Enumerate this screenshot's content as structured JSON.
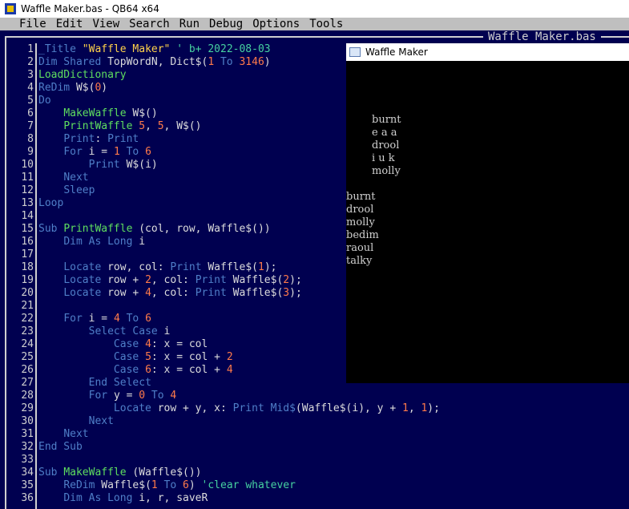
{
  "window": {
    "title": "Waffle Maker.bas - QB64 x64"
  },
  "menu": [
    "File",
    "Edit",
    "View",
    "Search",
    "Run",
    "Debug",
    "Options",
    "Tools"
  ],
  "editor": {
    "filename": "Waffle Maker.bas"
  },
  "line_numbers": [
    "1",
    "2",
    "3",
    "4",
    "5",
    "6",
    "7",
    "8",
    "9",
    "10",
    "11",
    "12",
    "13",
    "14",
    "15",
    "16",
    "17",
    "18",
    "19",
    "20",
    "21",
    "22",
    "23",
    "24",
    "25",
    "26",
    "27",
    "28",
    "29",
    "30",
    "31",
    "32",
    "33",
    "34",
    "35",
    "36"
  ],
  "code_lines": [
    [
      [
        "kw",
        "_Title "
      ],
      [
        "str",
        "\"Waffle Maker\""
      ],
      [
        "cm",
        " ' b+ 2022-08-03"
      ]
    ],
    [
      [
        "kw",
        "Dim Shared "
      ],
      [
        "txt",
        "TopWordN, Dict$("
      ],
      [
        "num",
        "1"
      ],
      [
        "kw",
        " To "
      ],
      [
        "num",
        "3146"
      ],
      [
        "txt",
        ")"
      ]
    ],
    [
      [
        "fn",
        "LoadDictionary"
      ]
    ],
    [
      [
        "kw",
        "ReDim "
      ],
      [
        "txt",
        "W$("
      ],
      [
        "num",
        "0"
      ],
      [
        "txt",
        ")"
      ]
    ],
    [
      [
        "kw",
        "Do"
      ]
    ],
    [
      [
        "txt",
        "    "
      ],
      [
        "fn",
        "MakeWaffle "
      ],
      [
        "txt",
        "W$()"
      ]
    ],
    [
      [
        "txt",
        "    "
      ],
      [
        "fn",
        "PrintWaffle "
      ],
      [
        "num",
        "5"
      ],
      [
        "txt",
        ", "
      ],
      [
        "num",
        "5"
      ],
      [
        "txt",
        ", W$()"
      ]
    ],
    [
      [
        "txt",
        "    "
      ],
      [
        "kw",
        "Print"
      ],
      [
        "txt",
        ": "
      ],
      [
        "kw",
        "Print"
      ]
    ],
    [
      [
        "txt",
        "    "
      ],
      [
        "kw",
        "For "
      ],
      [
        "txt",
        "i = "
      ],
      [
        "num",
        "1"
      ],
      [
        "kw",
        " To "
      ],
      [
        "num",
        "6"
      ]
    ],
    [
      [
        "txt",
        "        "
      ],
      [
        "kw",
        "Print "
      ],
      [
        "txt",
        "W$(i)"
      ]
    ],
    [
      [
        "txt",
        "    "
      ],
      [
        "kw",
        "Next"
      ]
    ],
    [
      [
        "txt",
        "    "
      ],
      [
        "kw",
        "Sleep"
      ]
    ],
    [
      [
        "kw",
        "Loop"
      ]
    ],
    [
      [
        "txt",
        ""
      ]
    ],
    [
      [
        "kw",
        "Sub "
      ],
      [
        "fn",
        "PrintWaffle "
      ],
      [
        "txt",
        "(col, row, Waffle$())"
      ]
    ],
    [
      [
        "txt",
        "    "
      ],
      [
        "kw",
        "Dim As Long "
      ],
      [
        "txt",
        "i"
      ]
    ],
    [
      [
        "txt",
        ""
      ]
    ],
    [
      [
        "txt",
        "    "
      ],
      [
        "kw",
        "Locate "
      ],
      [
        "txt",
        "row, col: "
      ],
      [
        "kw",
        "Print "
      ],
      [
        "txt",
        "Waffle$("
      ],
      [
        "num",
        "1"
      ],
      [
        "txt",
        ");"
      ]
    ],
    [
      [
        "txt",
        "    "
      ],
      [
        "kw",
        "Locate "
      ],
      [
        "txt",
        "row + "
      ],
      [
        "num",
        "2"
      ],
      [
        "txt",
        ", col: "
      ],
      [
        "kw",
        "Print "
      ],
      [
        "txt",
        "Waffle$("
      ],
      [
        "num",
        "2"
      ],
      [
        "txt",
        ");"
      ]
    ],
    [
      [
        "txt",
        "    "
      ],
      [
        "kw",
        "Locate "
      ],
      [
        "txt",
        "row + "
      ],
      [
        "num",
        "4"
      ],
      [
        "txt",
        ", col: "
      ],
      [
        "kw",
        "Print "
      ],
      [
        "txt",
        "Waffle$("
      ],
      [
        "num",
        "3"
      ],
      [
        "txt",
        ");"
      ]
    ],
    [
      [
        "txt",
        ""
      ]
    ],
    [
      [
        "txt",
        "    "
      ],
      [
        "kw",
        "For "
      ],
      [
        "txt",
        "i = "
      ],
      [
        "num",
        "4"
      ],
      [
        "kw",
        " To "
      ],
      [
        "num",
        "6"
      ]
    ],
    [
      [
        "txt",
        "        "
      ],
      [
        "kw",
        "Select Case "
      ],
      [
        "txt",
        "i"
      ]
    ],
    [
      [
        "txt",
        "            "
      ],
      [
        "kw",
        "Case "
      ],
      [
        "num",
        "4"
      ],
      [
        "txt",
        ": x = col"
      ]
    ],
    [
      [
        "txt",
        "            "
      ],
      [
        "kw",
        "Case "
      ],
      [
        "num",
        "5"
      ],
      [
        "txt",
        ": x = col + "
      ],
      [
        "num",
        "2"
      ]
    ],
    [
      [
        "txt",
        "            "
      ],
      [
        "kw",
        "Case "
      ],
      [
        "num",
        "6"
      ],
      [
        "txt",
        ": x = col + "
      ],
      [
        "num",
        "4"
      ]
    ],
    [
      [
        "txt",
        "        "
      ],
      [
        "kw",
        "End Select"
      ]
    ],
    [
      [
        "txt",
        "        "
      ],
      [
        "kw",
        "For "
      ],
      [
        "txt",
        "y = "
      ],
      [
        "num",
        "0"
      ],
      [
        "kw",
        " To "
      ],
      [
        "num",
        "4"
      ]
    ],
    [
      [
        "txt",
        "            "
      ],
      [
        "kw",
        "Locate "
      ],
      [
        "txt",
        "row + y, x: "
      ],
      [
        "kw",
        "Print "
      ],
      [
        "kw",
        "Mid$"
      ],
      [
        "txt",
        "(Waffle$(i), y + "
      ],
      [
        "num",
        "1"
      ],
      [
        "txt",
        ", "
      ],
      [
        "num",
        "1"
      ],
      [
        "txt",
        ");"
      ]
    ],
    [
      [
        "txt",
        "        "
      ],
      [
        "kw",
        "Next"
      ]
    ],
    [
      [
        "txt",
        "    "
      ],
      [
        "kw",
        "Next"
      ]
    ],
    [
      [
        "kw",
        "End Sub"
      ]
    ],
    [
      [
        "txt",
        ""
      ]
    ],
    [
      [
        "kw",
        "Sub "
      ],
      [
        "fn",
        "MakeWaffle "
      ],
      [
        "txt",
        "(Waffle$())"
      ]
    ],
    [
      [
        "txt",
        "    "
      ],
      [
        "kw",
        "ReDim "
      ],
      [
        "txt",
        "Waffle$("
      ],
      [
        "num",
        "1"
      ],
      [
        "kw",
        " To "
      ],
      [
        "num",
        "6"
      ],
      [
        "txt",
        ") "
      ],
      [
        "cm",
        "'clear whatever"
      ]
    ],
    [
      [
        "txt",
        "    "
      ],
      [
        "kw",
        "Dim As Long "
      ],
      [
        "txt",
        "i, r, saveR"
      ]
    ]
  ],
  "output_window": {
    "title": "Waffle Maker",
    "waffle_lines": [
      "burnt",
      "e a a",
      "drool",
      "i u k",
      "molly"
    ],
    "word_list": [
      "burnt",
      "drool",
      "molly",
      "bedim",
      "raoul",
      "talky"
    ]
  }
}
